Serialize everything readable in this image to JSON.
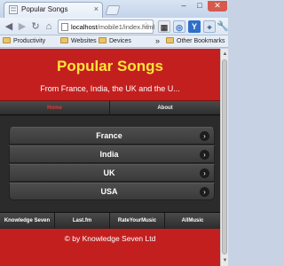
{
  "browser": {
    "tab_title": "Popular Songs",
    "tab_close": "×",
    "url_host": "localhost",
    "url_path": "/mobile1/index.html",
    "bookmarks": [
      "Productivity",
      "Websites",
      "Devices"
    ],
    "other_bookmarks": "Other Bookmarks"
  },
  "header": {
    "title": "Popular Songs",
    "subtitle": "From France, India, the UK and the U..."
  },
  "nav": {
    "tabs": [
      "Home",
      "About"
    ]
  },
  "list": {
    "items": [
      "France",
      "India",
      "UK",
      "USA"
    ]
  },
  "footer_nav": {
    "links": [
      "Knowledge Seven",
      "Last.fm",
      "RateYourMusic",
      "AllMusic"
    ]
  },
  "footer": {
    "text": "© by Knowledge Seven Ltd"
  },
  "colors": {
    "header_bg": "#c41f1f",
    "title": "#ffe43a",
    "active_tab": "#e13a3a",
    "page_bg": "#2b2b2b"
  }
}
